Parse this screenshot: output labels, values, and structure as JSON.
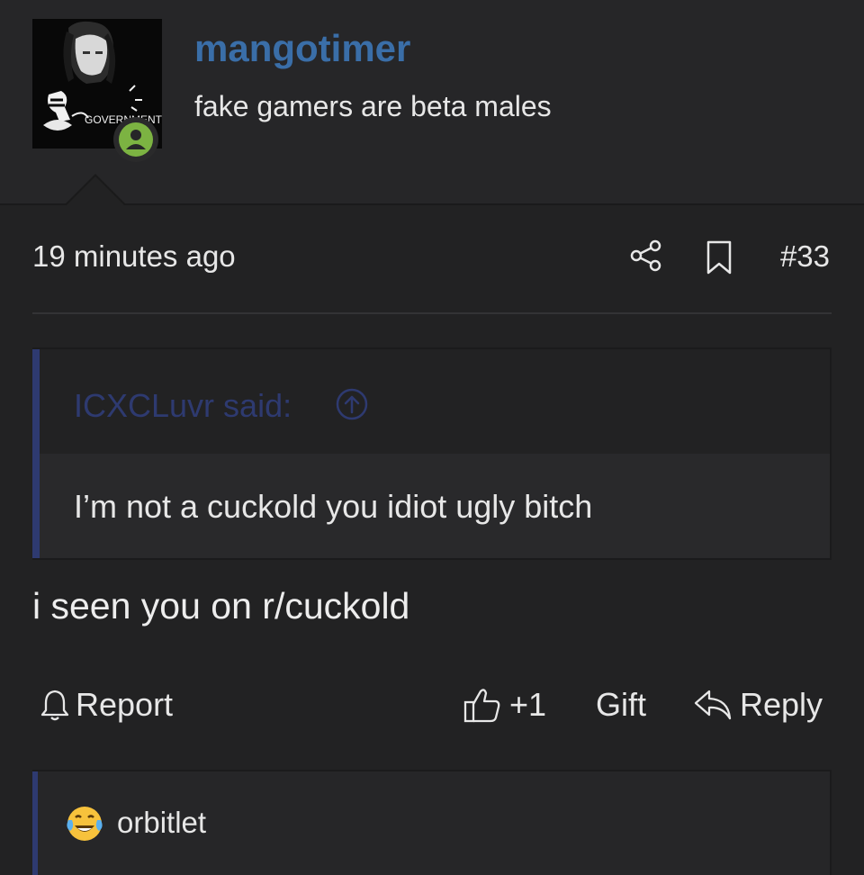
{
  "post": {
    "username": "mangotimer",
    "user_title": "fake gamers are beta males",
    "avatar_caption": "GOVERNMENT",
    "timestamp": "19 minutes ago",
    "post_number": "#33",
    "quote": {
      "author": "ICXCLuvr said:",
      "text": "I’m not a cuckold you idiot ugly bitch"
    },
    "message": "i seen you on r/cuckold",
    "actions": {
      "report": "Report",
      "like": "+1",
      "gift": "Gift",
      "reply": "Reply"
    },
    "reactions": {
      "emoji": "face-with-tears-of-joy-icon",
      "names": "orbitlet"
    }
  },
  "colors": {
    "background": "#222223",
    "username": "#3a6ea8",
    "quote_accent": "#2e3a70",
    "online": "#7cb342"
  }
}
